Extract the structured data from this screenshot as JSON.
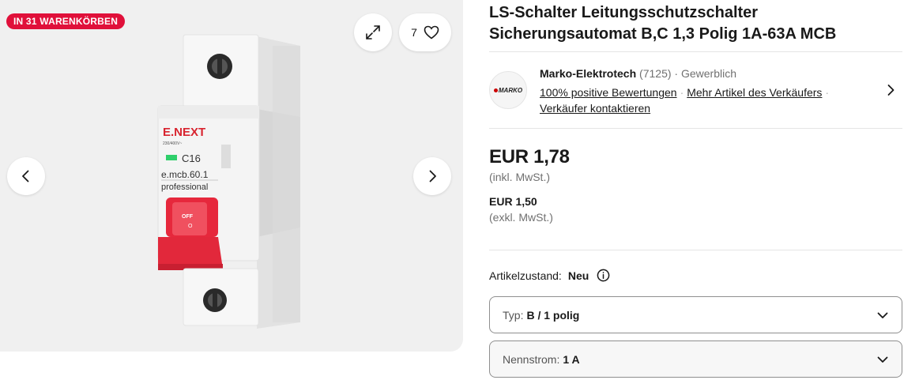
{
  "gallery": {
    "cart_badge": "IN 31 WARENKÖRBEN",
    "favorite_count": "7",
    "icons": {
      "expand": "expand-icon",
      "favorite": "heart-icon",
      "prev": "chevron-left-icon",
      "next": "chevron-right-icon"
    },
    "product_label": {
      "brand": "E.NEXT",
      "voltage": "230/400V~",
      "rating": "C16",
      "model": "e.mcb.60.1",
      "line": "professional",
      "lever": "OFF",
      "lever_sub": "O"
    }
  },
  "product": {
    "title": "LS-Schalter Leitungsschutzschalter Sicherungsautomat B,C 1,3 Polig 1A-63A MCB"
  },
  "seller": {
    "logo_text": "MARKO",
    "name": "Marko-Elektrotech",
    "feedback_count": "(7125)",
    "type_sep": "·",
    "type": "Gewerblich",
    "positive": "100% positive Bewertungen",
    "more_items": "Mehr Artikel des Verkäufers",
    "contact": "Verkäufer kontaktieren",
    "link_sep": "·"
  },
  "price": {
    "main": "EUR 1,78",
    "main_note": "(inkl. MwSt.)",
    "net": "EUR 1,50",
    "net_note": "(exkl. MwSt.)"
  },
  "condition": {
    "label": "Artikelzustand:",
    "value": "Neu"
  },
  "variants": [
    {
      "label": "Typ:",
      "value": "B / 1 polig"
    },
    {
      "label": "Nennstrom:",
      "value": "1 A"
    }
  ],
  "colors": {
    "badge": "#e0103a",
    "gallery_bg": "#f0f0f0",
    "lever_red": "#e6283c"
  }
}
